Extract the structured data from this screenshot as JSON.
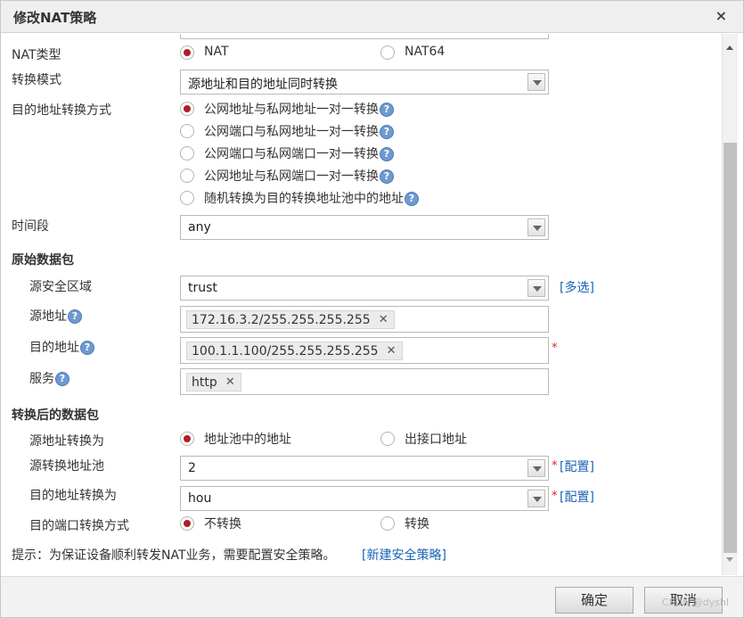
{
  "dialog": {
    "title": "修改NAT策略",
    "close": "×"
  },
  "nat_type": {
    "label": "NAT类型",
    "options": [
      {
        "text": "NAT",
        "checked": true
      },
      {
        "text": "NAT64",
        "checked": false
      }
    ]
  },
  "convert_mode": {
    "label": "转换模式",
    "value": "源地址和目的地址同时转换"
  },
  "dest_method": {
    "label": "目的地址转换方式",
    "options": [
      {
        "text": "公网地址与私网地址一对一转换",
        "checked": true
      },
      {
        "text": "公网端口与私网地址一对一转换",
        "checked": false
      },
      {
        "text": "公网端口与私网端口一对一转换",
        "checked": false
      },
      {
        "text": "公网地址与私网端口一对一转换",
        "checked": false
      },
      {
        "text": "随机转换为目的转换地址池中的地址",
        "checked": false
      }
    ]
  },
  "time_range": {
    "label": "时间段",
    "value": "any"
  },
  "original": {
    "section": "原始数据包",
    "src_zone": {
      "label": "源安全区域",
      "value": "trust",
      "multi": "[多选]"
    },
    "src_addr": {
      "label": "源地址",
      "tag": "172.16.3.2/255.255.255.255"
    },
    "dst_addr": {
      "label": "目的地址",
      "tag": "100.1.1.100/255.255.255.255",
      "required": "*"
    },
    "service": {
      "label": "服务",
      "tag": "http"
    }
  },
  "translated": {
    "section": "转换后的数据包",
    "src_translate": {
      "label": "源地址转换为",
      "options": [
        {
          "text": "地址池中的地址",
          "checked": true
        },
        {
          "text": "出接口地址",
          "checked": false
        }
      ]
    },
    "src_pool": {
      "label": "源转换地址池",
      "value": "2",
      "required": "*",
      "config": "[配置]"
    },
    "dst_translate": {
      "label": "目的地址转换为",
      "value": "hou",
      "required": "*",
      "config": "[配置]"
    },
    "dst_port": {
      "label": "目的端口转换方式",
      "options": [
        {
          "text": "不转换",
          "checked": true
        },
        {
          "text": "转换",
          "checked": false
        }
      ]
    }
  },
  "hint": {
    "text": "提示：为保证设备顺利转发NAT业务，需要配置安全策略。",
    "link": "[新建安全策略]"
  },
  "help_glyph": "?",
  "tag_remove": "✕",
  "buttons": {
    "ok": "确定",
    "cancel": "取消"
  },
  "watermark": "CSDN @dyshl",
  "colors": {
    "radio_checked": "#b01e22",
    "link": "#1a63b4",
    "required": "#e02020",
    "help_icon": "#6f9ad1"
  }
}
